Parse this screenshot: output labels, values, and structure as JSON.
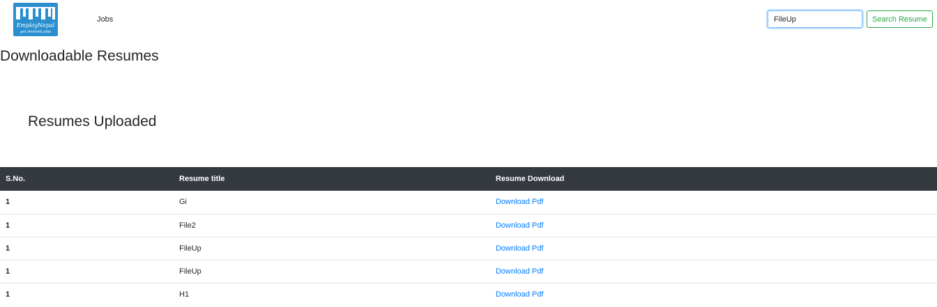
{
  "brand": {
    "logo_text_line1": "EmployNepal",
    "logo_text_line2": "get desired jobs",
    "color": "#2b8fcf"
  },
  "nav": {
    "jobs_label": "Jobs"
  },
  "search": {
    "value": "FileUp",
    "button_label": "Search Resume",
    "button_color": "#28a745"
  },
  "page_title": "Downloadable Resumes",
  "section_title": "Resumes Uploaded",
  "table": {
    "headers": [
      "S.No.",
      "Resume title",
      "Resume Download"
    ],
    "rows": [
      {
        "sno": "1",
        "title": "Gi",
        "download": "Download Pdf"
      },
      {
        "sno": "1",
        "title": "File2",
        "download": "Download Pdf"
      },
      {
        "sno": "1",
        "title": "FileUp",
        "download": "Download Pdf"
      },
      {
        "sno": "1",
        "title": "FileUp",
        "download": "Download Pdf"
      },
      {
        "sno": "1",
        "title": "H1",
        "download": "Download Pdf"
      }
    ],
    "header_bg": "#343a40",
    "link_color": "#007bff"
  }
}
